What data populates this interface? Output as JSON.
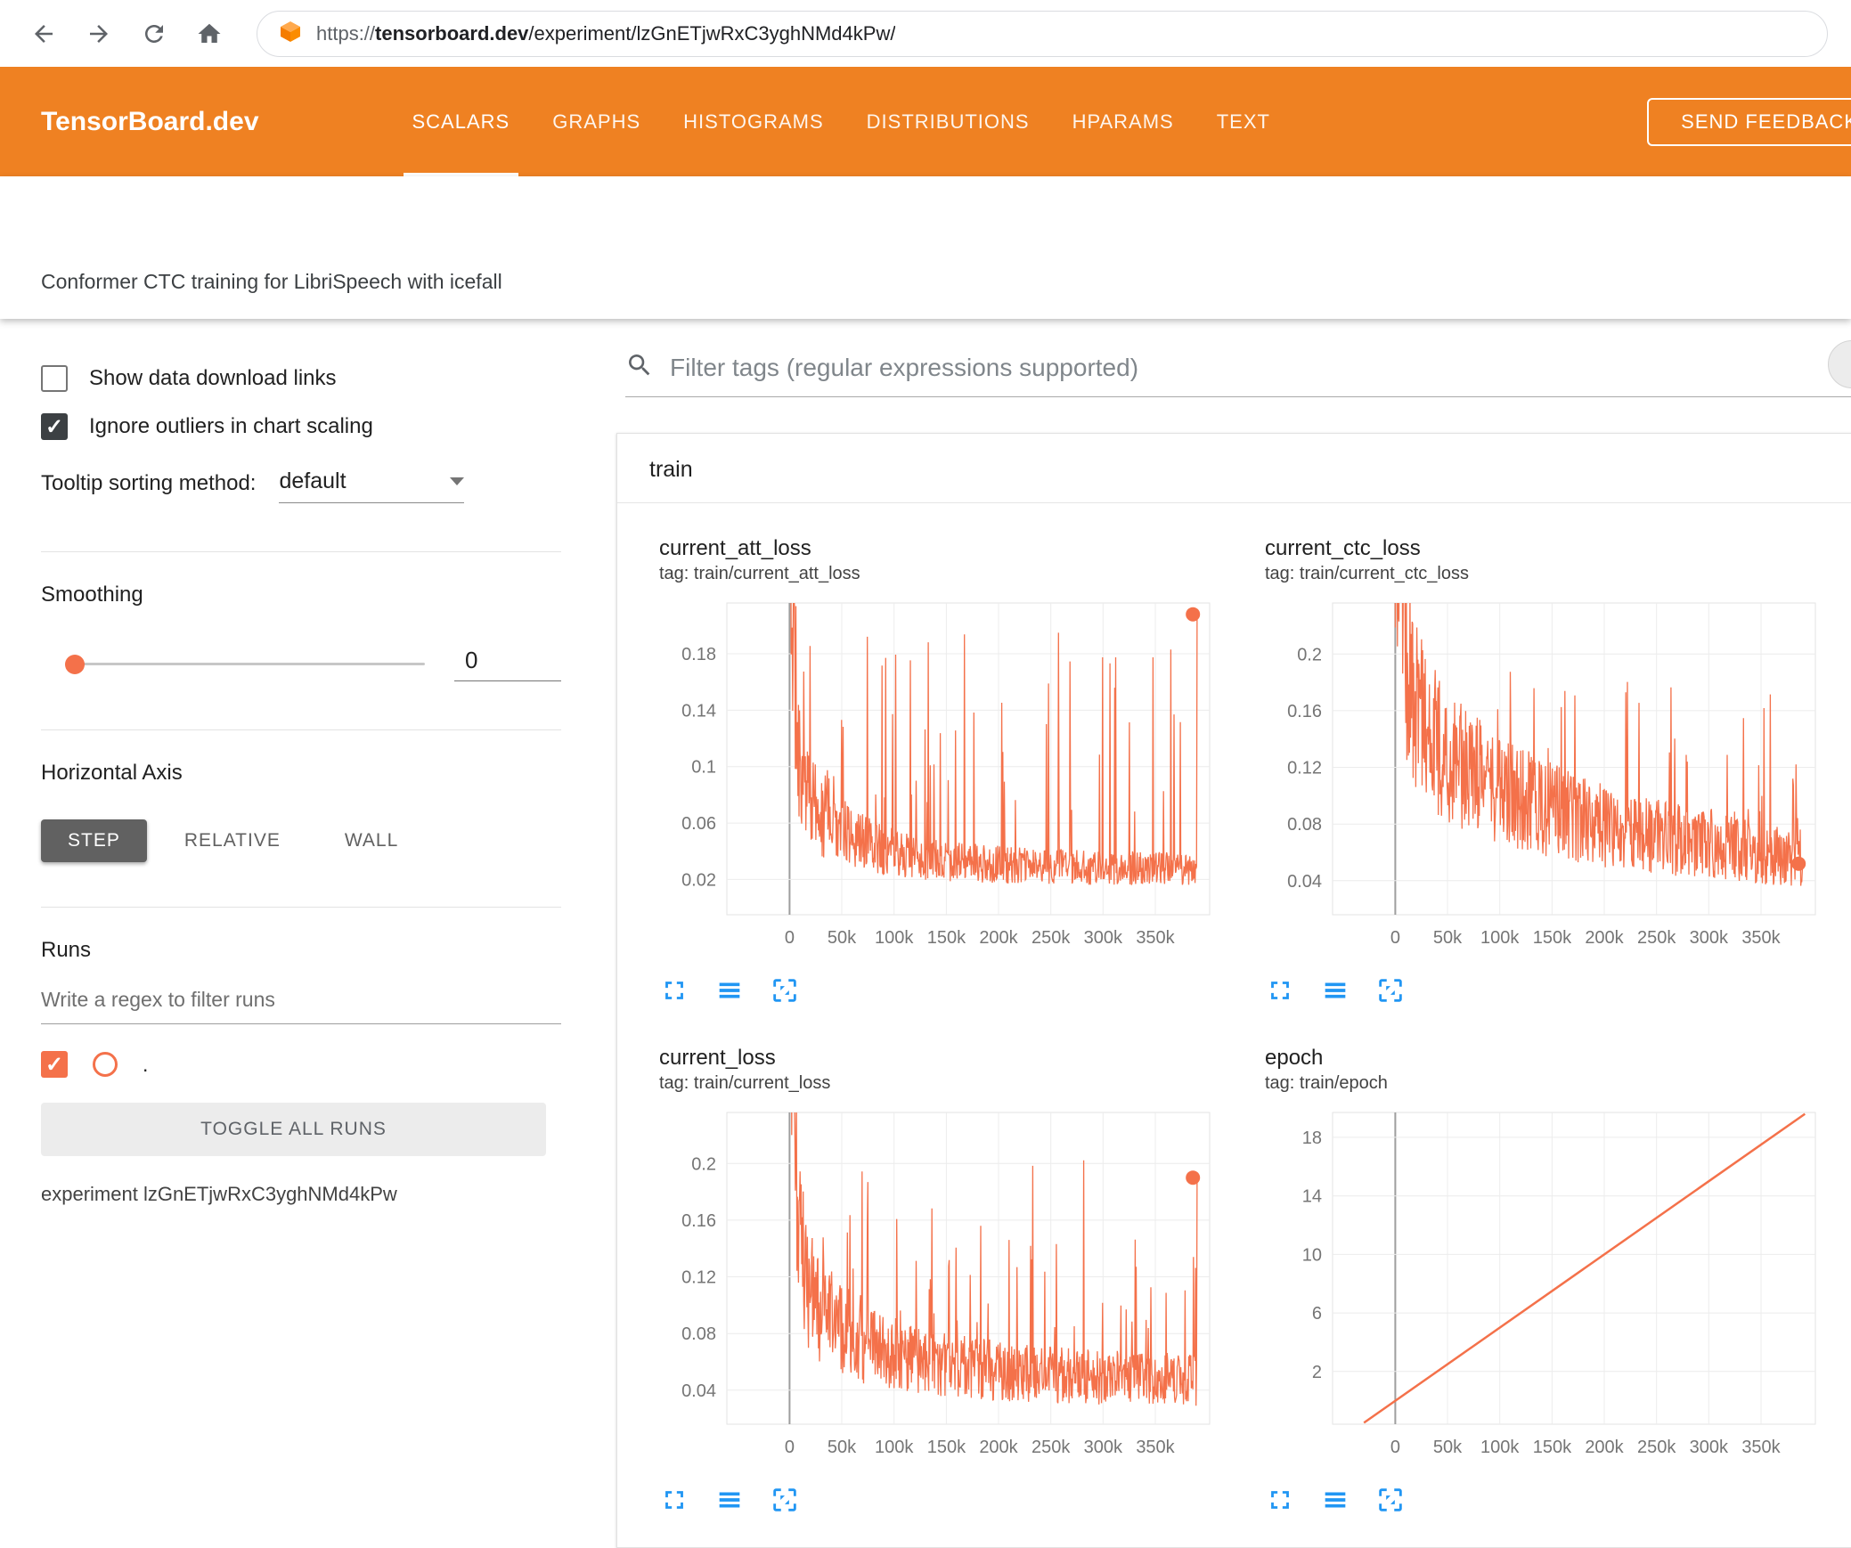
{
  "browser": {
    "url_scheme": "https://",
    "url_domain": "tensorboard.dev",
    "url_path": "/experiment/lzGnETjwRxC3yghNMd4kPw/"
  },
  "header": {
    "brand": "TensorBoard.dev",
    "tabs": [
      {
        "label": "SCALARS",
        "active": true
      },
      {
        "label": "GRAPHS",
        "active": false
      },
      {
        "label": "HISTOGRAMS",
        "active": false
      },
      {
        "label": "DISTRIBUTIONS",
        "active": false
      },
      {
        "label": "HPARAMS",
        "active": false
      },
      {
        "label": "TEXT",
        "active": false
      }
    ],
    "feedback_label": "SEND FEEDBACK"
  },
  "experiment": {
    "title": "Conformer CTC training for LibriSpeech with icefall"
  },
  "sidebar": {
    "show_download": {
      "label": "Show data download links",
      "checked": false
    },
    "ignore_outliers": {
      "label": "Ignore outliers in chart scaling",
      "checked": true
    },
    "tooltip_sort": {
      "label": "Tooltip sorting method:",
      "value": "default"
    },
    "smoothing": {
      "label": "Smoothing",
      "value": "0"
    },
    "horizontal_axis": {
      "label": "Horizontal Axis",
      "options": [
        "STEP",
        "RELATIVE",
        "WALL"
      ],
      "selected": "STEP"
    },
    "runs": {
      "label": "Runs",
      "filter_placeholder": "Write a regex to filter runs",
      "run_checked": true,
      "run_name": ".",
      "toggle_label": "TOGGLE ALL RUNS",
      "experiment_label": "experiment lzGnETjwRxC3yghNMd4kPw"
    }
  },
  "main": {
    "filter_placeholder": "Filter tags (regular expressions supported)",
    "group_label": "train",
    "chart_toolbar_icons": [
      "fullscreen-icon",
      "lines-icon",
      "fit-domain-icon"
    ]
  },
  "colors": {
    "header_orange": "#ef8122",
    "line_orange": "#f4714a",
    "icon_blue": "#2196f3",
    "axis_selected_bg": "#616161"
  },
  "chart_data": [
    {
      "type": "line",
      "title": "current_att_loss",
      "tag": "tag: train/current_att_loss",
      "x_range": [
        -60000,
        402000
      ],
      "x_ticks": [
        [
          0,
          "0"
        ],
        [
          50000,
          "50k"
        ],
        [
          100000,
          "100k"
        ],
        [
          150000,
          "150k"
        ],
        [
          200000,
          "200k"
        ],
        [
          250000,
          "250k"
        ],
        [
          300000,
          "300k"
        ],
        [
          350000,
          "350k"
        ]
      ],
      "ylim": [
        -0.005,
        0.216
      ],
      "y_ticks": [
        [
          0.02,
          "0.02"
        ],
        [
          0.06,
          "0.06"
        ],
        [
          0.1,
          "0.1"
        ],
        [
          0.14,
          "0.14"
        ],
        [
          0.18,
          "0.18"
        ]
      ],
      "grid": true,
      "end_dot": [
        386000,
        0.208
      ],
      "series": [
        {
          "name": ".",
          "color": "#f4714a",
          "gen": "noisy",
          "seed": 11,
          "points": 780,
          "x_data": [
            -2000,
            390000
          ],
          "trend": [
            [
              -2000,
              0.32
            ],
            [
              3000,
              0.18
            ],
            [
              8000,
              0.1
            ],
            [
              15000,
              0.072
            ],
            [
              30000,
              0.056
            ],
            [
              50000,
              0.047
            ],
            [
              80000,
              0.038
            ],
            [
              120000,
              0.031
            ],
            [
              160000,
              0.028
            ],
            [
              220000,
              0.026
            ],
            [
              280000,
              0.025
            ],
            [
              340000,
              0.024
            ],
            [
              390000,
              0.024
            ]
          ],
          "noise_amp": 0.5,
          "spike_prob": 0.07,
          "spike_top": 0.205,
          "spike_fall": 0.05,
          "end_value": 0.208
        }
      ]
    },
    {
      "type": "line",
      "title": "current_ctc_loss",
      "tag": "tag: train/current_ctc_loss",
      "x_range": [
        -60000,
        402000
      ],
      "x_ticks": [
        [
          0,
          "0"
        ],
        [
          50000,
          "50k"
        ],
        [
          100000,
          "100k"
        ],
        [
          150000,
          "150k"
        ],
        [
          200000,
          "200k"
        ],
        [
          250000,
          "250k"
        ],
        [
          300000,
          "300k"
        ],
        [
          350000,
          "350k"
        ]
      ],
      "ylim": [
        0.016,
        0.236
      ],
      "y_ticks": [
        [
          0.04,
          "0.04"
        ],
        [
          0.08,
          "0.08"
        ],
        [
          0.12,
          "0.12"
        ],
        [
          0.16,
          "0.16"
        ],
        [
          0.2,
          "0.2"
        ]
      ],
      "grid": true,
      "end_dot": [
        386000,
        0.052
      ],
      "series": [
        {
          "name": ".",
          "color": "#f4714a",
          "gen": "noisy",
          "seed": 23,
          "points": 780,
          "x_data": [
            -2000,
            390000
          ],
          "trend": [
            [
              -2000,
              0.34
            ],
            [
              4000,
              0.24
            ],
            [
              10000,
              0.18
            ],
            [
              20000,
              0.145
            ],
            [
              35000,
              0.125
            ],
            [
              60000,
              0.108
            ],
            [
              100000,
              0.092
            ],
            [
              140000,
              0.082
            ],
            [
              180000,
              0.073
            ],
            [
              220000,
              0.067
            ],
            [
              260000,
              0.062
            ],
            [
              300000,
              0.058
            ],
            [
              350000,
              0.053
            ],
            [
              390000,
              0.05
            ]
          ],
          "noise_amp": 0.42,
          "spike_prob": 0.05,
          "spike_top": 0.2,
          "spike_fall": 0.1,
          "end_value": 0.052
        }
      ]
    },
    {
      "type": "line",
      "title": "current_loss",
      "tag": "tag: train/current_loss",
      "x_range": [
        -60000,
        402000
      ],
      "x_ticks": [
        [
          0,
          "0"
        ],
        [
          50000,
          "50k"
        ],
        [
          100000,
          "100k"
        ],
        [
          150000,
          "150k"
        ],
        [
          200000,
          "200k"
        ],
        [
          250000,
          "250k"
        ],
        [
          300000,
          "300k"
        ],
        [
          350000,
          "350k"
        ]
      ],
      "ylim": [
        0.016,
        0.236
      ],
      "y_ticks": [
        [
          0.04,
          "0.04"
        ],
        [
          0.08,
          "0.08"
        ],
        [
          0.12,
          "0.12"
        ],
        [
          0.16,
          "0.16"
        ],
        [
          0.2,
          "0.2"
        ]
      ],
      "grid": true,
      "end_dot": [
        386000,
        0.19
      ],
      "series": [
        {
          "name": ".",
          "color": "#f4714a",
          "gen": "noisy",
          "seed": 37,
          "points": 780,
          "x_data": [
            -2000,
            390000
          ],
          "trend": [
            [
              -2000,
              0.36
            ],
            [
              3000,
              0.22
            ],
            [
              8000,
              0.14
            ],
            [
              15000,
              0.105
            ],
            [
              30000,
              0.085
            ],
            [
              50000,
              0.072
            ],
            [
              80000,
              0.062
            ],
            [
              120000,
              0.054
            ],
            [
              160000,
              0.05
            ],
            [
              220000,
              0.046
            ],
            [
              280000,
              0.044
            ],
            [
              340000,
              0.042
            ],
            [
              390000,
              0.042
            ]
          ],
          "noise_amp": 0.45,
          "spike_prob": 0.065,
          "spike_top": 0.21,
          "spike_fall": 0.05,
          "end_value": 0.19
        }
      ]
    },
    {
      "type": "line",
      "title": "epoch",
      "tag": "tag: train/epoch",
      "x_range": [
        -60000,
        402000
      ],
      "x_ticks": [
        [
          0,
          "0"
        ],
        [
          50000,
          "50k"
        ],
        [
          100000,
          "100k"
        ],
        [
          150000,
          "150k"
        ],
        [
          200000,
          "200k"
        ],
        [
          250000,
          "250k"
        ],
        [
          300000,
          "300k"
        ],
        [
          350000,
          "350k"
        ]
      ],
      "ylim": [
        -1.6,
        19.7
      ],
      "y_ticks": [
        [
          2,
          "2"
        ],
        [
          6,
          "6"
        ],
        [
          10,
          "10"
        ],
        [
          14,
          "14"
        ],
        [
          18,
          "18"
        ]
      ],
      "grid": true,
      "series": [
        {
          "name": ".",
          "color": "#f4714a",
          "gen": "linear",
          "width": 2.5,
          "trend": [
            [
              -30000,
              -1.5
            ],
            [
              392000,
              19.6
            ]
          ]
        }
      ]
    }
  ]
}
